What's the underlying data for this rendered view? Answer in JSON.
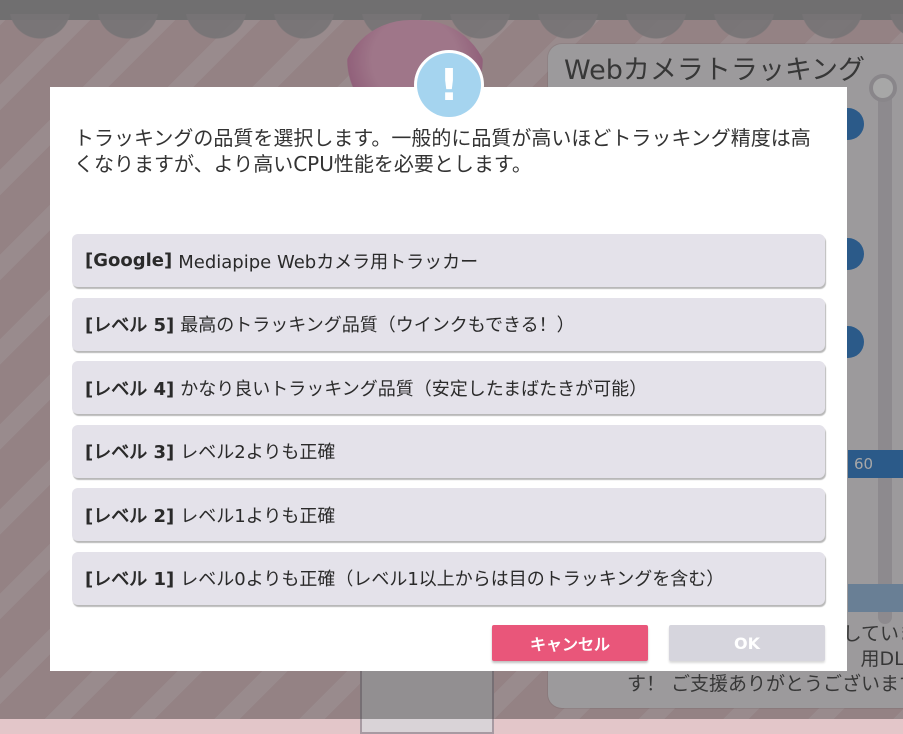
{
  "panel": {
    "title": "Webカメラトラッキング",
    "value": "60",
    "footer_line1": "していま",
    "footer_line2": "用DLC",
    "footer_line3": "す！ ご支援ありがとうございます"
  },
  "dialog": {
    "icon": "exclamation-icon",
    "icon_glyph": "!",
    "message": "トラッキングの品質を選択します。一般的に品質が高いほどトラッキング精度は高くなりますが、より高いCPU性能を必要とします。",
    "options": [
      {
        "tag": "[Google]",
        "label": "Mediapipe Webカメラ用トラッカー"
      },
      {
        "tag": "[レベル 5]",
        "label": "最高のトラッキング品質（ウインクもできる！）"
      },
      {
        "tag": "[レベル 4]",
        "label": "かなり良いトラッキング品質（安定したまばたきが可能）"
      },
      {
        "tag": "[レベル 3]",
        "label": "レベル2よりも正確"
      },
      {
        "tag": "[レベル 2]",
        "label": "レベル1よりも正確"
      },
      {
        "tag": "[レベル 1]",
        "label": "レベル0よりも正確（レベル1以上からは目のトラッキングを含む）"
      }
    ],
    "cancel_label": "キャンセル",
    "ok_label": "OK"
  },
  "colors": {
    "accent_blue": "#1e73c8",
    "cancel_pink": "#e9567a",
    "alert_blue": "#a5d4ef"
  }
}
